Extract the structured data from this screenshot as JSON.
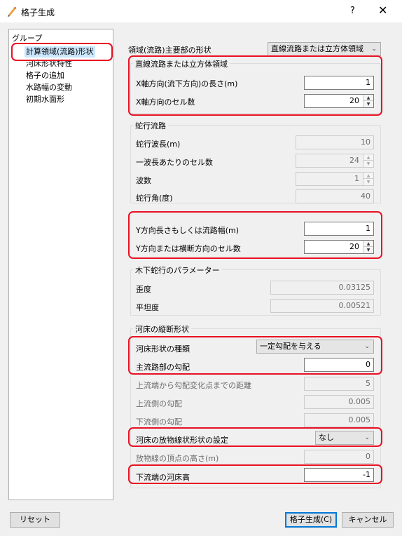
{
  "window": {
    "title": "格子生成",
    "help": "?",
    "close": "✕"
  },
  "group_panel": {
    "header": "グループ",
    "items": [
      {
        "label": "計算領域(流路)形状",
        "selected": true
      },
      {
        "label": "河床形状特性"
      },
      {
        "label": "格子の追加"
      },
      {
        "label": "水路幅の変動"
      },
      {
        "label": "初期水面形"
      }
    ]
  },
  "main": {
    "shape_label": "領域(流路)主要部の形状",
    "shape_value": "直線流路または立方体領域",
    "straight_group": {
      "title": "直線流路または立方体領域",
      "x_length_label": "X軸方向(流下方向)の長さ(m)",
      "x_length_value": "1",
      "x_cells_label": "X軸方向のセル数",
      "x_cells_value": "20"
    },
    "meander_group": {
      "title": "蛇行流路",
      "wavelength_label": "蛇行波長(m)",
      "wavelength_value": "10",
      "cells_per_wave_label": "一波長あたりのセル数",
      "cells_per_wave_value": "24",
      "waves_label": "波数",
      "waves_value": "1",
      "angle_label": "蛇行角(度)",
      "angle_value": "40"
    },
    "y_section": {
      "y_length_label": "Y方向長さもしくは流路幅(m)",
      "y_length_value": "1",
      "y_cells_label": "Y方向または横断方向のセル数",
      "y_cells_value": "20"
    },
    "kinoshita_group": {
      "title": "木下蛇行のパラメーター",
      "skewness_label": "歪度",
      "skewness_value": "0.03125",
      "flatness_label": "平坦度",
      "flatness_value": "0.00521"
    },
    "bed_group": {
      "title": "河床の縦断形状",
      "type_label": "河床形状の種類",
      "type_value": "一定勾配を与える",
      "main_slope_label": "主流路部の勾配",
      "main_slope_value": "0",
      "upstream_dist_label": "上流端から勾配変化点までの距離",
      "upstream_dist_value": "5",
      "upstream_slope_label": "上流側の勾配",
      "upstream_slope_value": "0.005",
      "downstream_slope_label": "下流側の勾配",
      "downstream_slope_value": "0.005",
      "parabola_label": "河床の放物線状形状の設定",
      "parabola_value": "なし",
      "vertex_label": "放物線の頂点の高さ(m)",
      "vertex_value": "0",
      "downstream_bed_label": "下流端の河床高",
      "downstream_bed_value": "-1"
    }
  },
  "buttons": {
    "reset": "リセット",
    "generate": "格子生成(C)",
    "cancel": "キャンセル"
  }
}
